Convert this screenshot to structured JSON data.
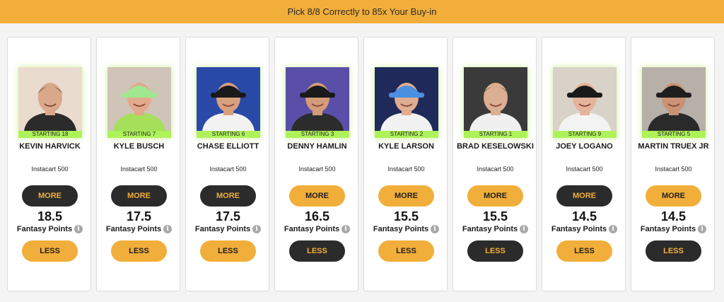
{
  "banner": {
    "text": "Pick 8/8 Correctly to 85x Your Buy-in"
  },
  "labels": {
    "more": "MORE",
    "less": "LESS",
    "fantasy_points": "Fantasy Points",
    "info_glyph": "i"
  },
  "players": [
    {
      "name": "KEVIN HARVICK",
      "starting": "STARTING 18",
      "event": "Instacart 500",
      "points": "18.5",
      "more_style": "dark",
      "less_style": "gold",
      "photo": {
        "bg": "#e9dccf",
        "skin": "#d9a88a",
        "hair": "#4a3a2e",
        "cap": "none",
        "cap_color": "",
        "shirt": "#2b2b2b"
      }
    },
    {
      "name": "KYLE BUSCH",
      "starting": "STARTING 7",
      "event": "Instacart 500",
      "points": "17.5",
      "more_style": "dark",
      "less_style": "gold",
      "photo": {
        "bg": "#cfc4b7",
        "skin": "#e2a98e",
        "hair": "",
        "cap": "cap",
        "cap_color": "#9fe88f",
        "shirt": "#a6e05a"
      }
    },
    {
      "name": "CHASE ELLIOTT",
      "starting": "STARTING 6",
      "event": "Instacart 500",
      "points": "17.5",
      "more_style": "dark",
      "less_style": "gold",
      "photo": {
        "bg": "#2a4aa8",
        "skin": "#d9a07e",
        "hair": "",
        "cap": "cap",
        "cap_color": "#1a1a1a",
        "shirt": "#f2f2f2"
      }
    },
    {
      "name": "DENNY HAMLIN",
      "starting": "STARTING 3",
      "event": "Instacart 500",
      "points": "16.5",
      "more_style": "gold",
      "less_style": "dark",
      "photo": {
        "bg": "#5a4fa8",
        "skin": "#d39b79",
        "hair": "",
        "cap": "cap",
        "cap_color": "#1a1a1a",
        "shirt": "#2c2c2c"
      }
    },
    {
      "name": "KYLE LARSON",
      "starting": "STARTING 2",
      "event": "Instacart 500",
      "points": "15.5",
      "more_style": "gold",
      "less_style": "gold",
      "photo": {
        "bg": "#1f2a5a",
        "skin": "#e0ad90",
        "hair": "",
        "cap": "cap",
        "cap_color": "#4a8fe0",
        "shirt": "#f1f1f1"
      }
    },
    {
      "name": "BRAD KESELOWSKI",
      "starting": "STARTING 1",
      "event": "Instacart 500",
      "points": "15.5",
      "more_style": "gold",
      "less_style": "dark",
      "photo": {
        "bg": "#3a3a3a",
        "skin": "#dcae92",
        "hair": "#7a5a3a",
        "cap": "none",
        "cap_color": "",
        "shirt": "#f0f0f0"
      }
    },
    {
      "name": "JOEY LOGANO",
      "starting": "STARTING 9",
      "event": "Instacart 500",
      "points": "14.5",
      "more_style": "dark",
      "less_style": "gold",
      "photo": {
        "bg": "#d8d2c8",
        "skin": "#e4b49a",
        "hair": "",
        "cap": "cap",
        "cap_color": "#1a1a1a",
        "shirt": "#f3f3f3"
      }
    },
    {
      "name": "MARTIN TRUEX JR",
      "starting": "STARTING 5",
      "event": "Instacart 500",
      "points": "14.5",
      "more_style": "gold",
      "less_style": "dark",
      "photo": {
        "bg": "#b7b0a8",
        "skin": "#c99274",
        "hair": "",
        "cap": "cap",
        "cap_color": "#1e1e1e",
        "shirt": "#2a2a2a"
      }
    }
  ]
}
